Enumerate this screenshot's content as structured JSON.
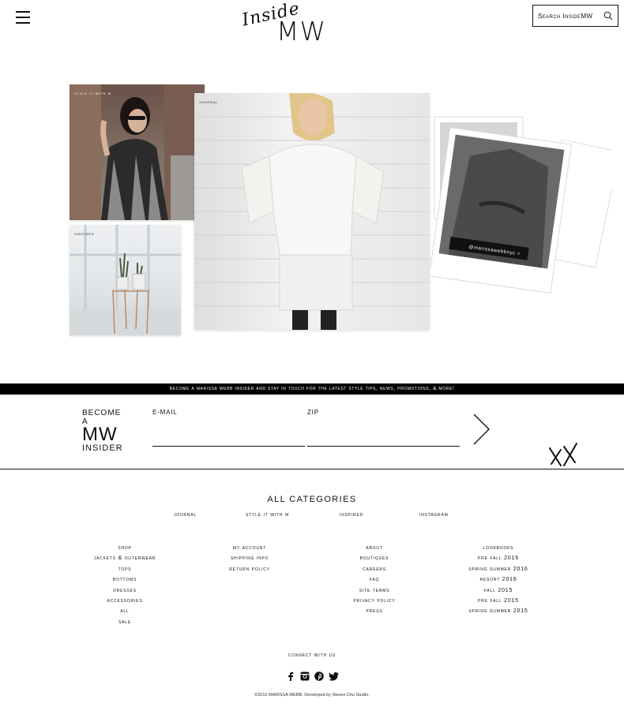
{
  "header": {
    "logo_script": "Inside",
    "logo_mw": "MW",
    "search_placeholder": "Search InsideMW"
  },
  "tiles": {
    "style_label": "style it with m",
    "journal_label": "journal",
    "inspired_label": "inspired",
    "instagram_handle": "@marissawebbnyc >"
  },
  "signup": {
    "banner": "become a marissa webb insider and stay in touch for the latest style tips, news, promotions, & more!",
    "title_top": "BECOME A",
    "title_mid": "MW",
    "title_bottom": "INSIDER",
    "email_label": "E-MAIL",
    "zip_label": "ZIP",
    "email_value": "",
    "zip_value": "",
    "xx": "XX"
  },
  "footer": {
    "all_categories": "ALL CATEGORIES",
    "categories": [
      "journal",
      "style it with m",
      "inspired",
      "instagram"
    ],
    "shop": [
      "shop",
      "jackets & outerwear",
      "tops",
      "bottoms",
      "dresses",
      "accessories",
      "all",
      "sale"
    ],
    "account": [
      "my account",
      "shipping info",
      "return policy"
    ],
    "company": [
      "about",
      "boutiques",
      "careers",
      "faq",
      "site terms",
      "privacy policy",
      "press"
    ],
    "lookbooks": [
      "lookbooks",
      "pre fall 2016",
      "spring summer 2016",
      "resort 2016",
      "fall 2015",
      "pre fall 2015",
      "spring summer 2015"
    ],
    "connect": "connect with us",
    "social_icons": [
      "facebook-icon",
      "instagram-icon",
      "pinterest-icon",
      "twitter-icon"
    ],
    "copyright": "©2015 MARISSA WEBB. Developed by Steven Chu Studio."
  }
}
